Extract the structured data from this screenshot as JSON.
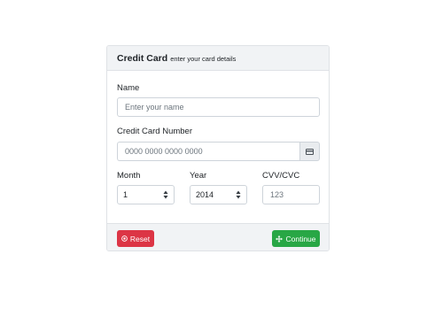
{
  "card": {
    "title": "Credit Card",
    "subtitle": "enter your card details"
  },
  "name": {
    "label": "Name",
    "placeholder": "Enter your name",
    "value": ""
  },
  "credit_card": {
    "label": "Credit Card Number",
    "placeholder": "0000 0000 0000 0000",
    "value": "",
    "addon_icon": "credit-card-icon"
  },
  "month": {
    "label": "Month",
    "selected": "1"
  },
  "year": {
    "label": "Year",
    "selected": "2014"
  },
  "cvv": {
    "label": "CVV/CVC",
    "placeholder": "123",
    "value": ""
  },
  "footer": {
    "reset_label": "Reset",
    "reset_icon": "reset-circle-icon",
    "continue_label": "Continue",
    "continue_icon": "move-arrows-icon"
  },
  "colors": {
    "danger": "#dc3545",
    "success": "#28a745",
    "header_bg": "#f1f3f5",
    "border": "#ced4da"
  }
}
